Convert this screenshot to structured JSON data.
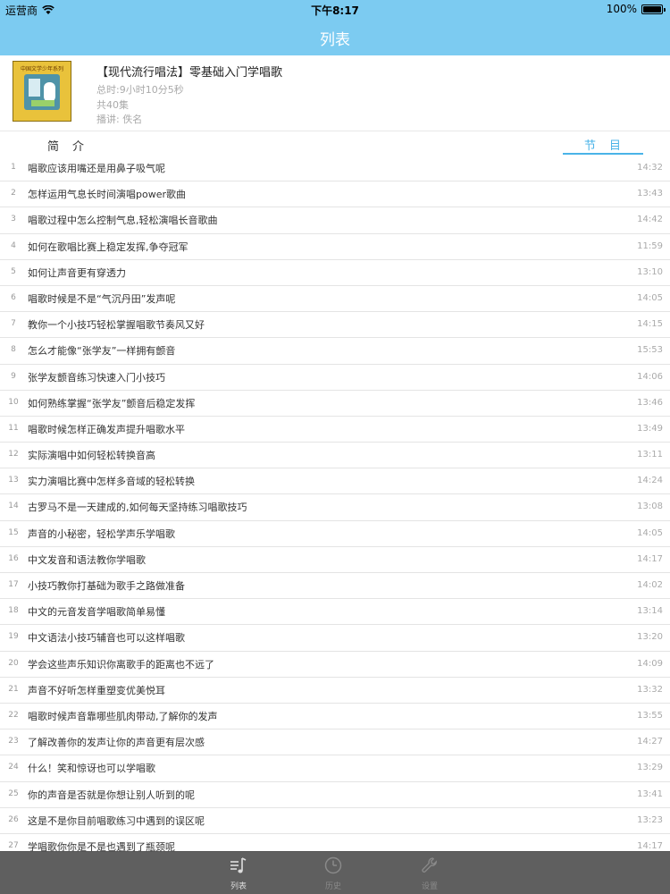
{
  "status_bar": {
    "carrier": "运营商",
    "time": "下午8:17",
    "battery": "100%"
  },
  "nav": {
    "title": "列表"
  },
  "album": {
    "cover_caption": "中国文学少年系列",
    "title": "【现代流行唱法】零基础入门学唱歌",
    "total_duration": "总时:9小时10分5秒",
    "episode_count": "共40集",
    "narrator": "播讲: 佚名"
  },
  "tabs": {
    "intro": "简　介",
    "episodes": "节　目"
  },
  "episodes": [
    {
      "num": "1",
      "title": "唱歌应该用嘴还是用鼻子吸气呢",
      "duration": "14:32"
    },
    {
      "num": "2",
      "title": "怎样运用气息长时间演唱power歌曲",
      "duration": "13:43"
    },
    {
      "num": "3",
      "title": "唱歌过程中怎么控制气息,轻松演唱长音歌曲",
      "duration": "14:42"
    },
    {
      "num": "4",
      "title": "如何在歌唱比赛上稳定发挥,争夺冠军",
      "duration": "11:59"
    },
    {
      "num": "5",
      "title": "如何让声音更有穿透力",
      "duration": "13:10"
    },
    {
      "num": "6",
      "title": "唱歌时候是不是“气沉丹田”发声呢",
      "duration": "14:05"
    },
    {
      "num": "7",
      "title": "教你一个小技巧轻松掌握唱歌节奏风又好",
      "duration": "14:15"
    },
    {
      "num": "8",
      "title": "怎么才能像“张学友”一样拥有颤音",
      "duration": "15:53"
    },
    {
      "num": "9",
      "title": "张学友颤音练习快速入门小技巧",
      "duration": "14:06"
    },
    {
      "num": "10",
      "title": "如何熟练掌握“张学友”颤音后稳定发挥",
      "duration": "13:46"
    },
    {
      "num": "11",
      "title": "唱歌时候怎样正确发声提升唱歌水平",
      "duration": "13:49"
    },
    {
      "num": "12",
      "title": "实际演唱中如何轻松转换音高",
      "duration": "13:11"
    },
    {
      "num": "13",
      "title": "实力演唱比赛中怎样多音域的轻松转换",
      "duration": "14:24"
    },
    {
      "num": "14",
      "title": "古罗马不是一天建成的,如何每天坚持练习唱歌技巧",
      "duration": "13:08"
    },
    {
      "num": "15",
      "title": "声音的小秘密，轻松学声乐学唱歌",
      "duration": "14:05"
    },
    {
      "num": "16",
      "title": "中文发音和语法教你学唱歌",
      "duration": "14:17"
    },
    {
      "num": "17",
      "title": "小技巧教你打基础为歌手之路做准备",
      "duration": "14:02"
    },
    {
      "num": "18",
      "title": "中文的元音发音学唱歌简单易懂",
      "duration": "13:14"
    },
    {
      "num": "19",
      "title": "中文语法小技巧辅音也可以这样唱歌",
      "duration": "13:20"
    },
    {
      "num": "20",
      "title": "学会这些声乐知识你离歌手的距离也不远了",
      "duration": "14:09"
    },
    {
      "num": "21",
      "title": "声音不好听怎样重塑变优美悦耳",
      "duration": "13:32"
    },
    {
      "num": "22",
      "title": "唱歌时候声音靠哪些肌肉带动,了解你的发声",
      "duration": "13:55"
    },
    {
      "num": "23",
      "title": "了解改善你的发声让你的声音更有层次感",
      "duration": "14:27"
    },
    {
      "num": "24",
      "title": "什么！笑和惊讶也可以学唱歌",
      "duration": "13:29"
    },
    {
      "num": "25",
      "title": "你的声音是否就是你想让别人听到的呢",
      "duration": "13:41"
    },
    {
      "num": "26",
      "title": "这是不是你目前唱歌练习中遇到的误区呢",
      "duration": "13:23"
    },
    {
      "num": "27",
      "title": "学唱歌你你是不是也遇到了瓶颈呢",
      "duration": "14:17"
    }
  ],
  "tabbar": {
    "list": "列表",
    "history": "历史",
    "settings": "设置"
  },
  "colors": {
    "nav": "#7ccbf1",
    "accent": "#4ab3e8",
    "tabbar": "#5f5f5f"
  }
}
